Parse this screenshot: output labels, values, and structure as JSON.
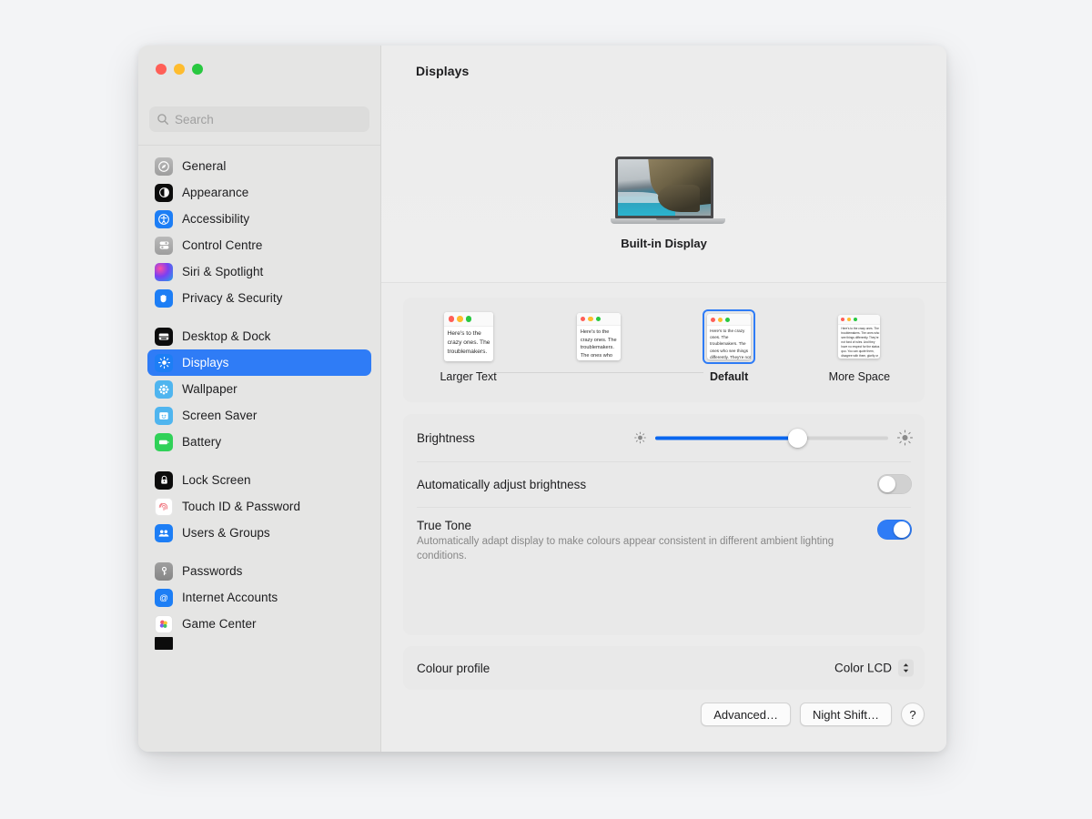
{
  "window": {
    "traffic_lights": [
      "close",
      "minimise",
      "zoom"
    ],
    "accent_color": "#2f7cf6"
  },
  "sidebar": {
    "search": {
      "placeholder": "Search",
      "value": ""
    },
    "groups": [
      {
        "items": [
          {
            "label": "General",
            "icon": "general-icon",
            "selected": false
          },
          {
            "label": "Appearance",
            "icon": "appearance-icon",
            "selected": false
          },
          {
            "label": "Accessibility",
            "icon": "accessibility-icon",
            "selected": false
          },
          {
            "label": "Control Centre",
            "icon": "control-centre-icon",
            "selected": false
          },
          {
            "label": "Siri & Spotlight",
            "icon": "siri-spotlight-icon",
            "selected": false
          },
          {
            "label": "Privacy & Security",
            "icon": "privacy-security-icon",
            "selected": false
          }
        ]
      },
      {
        "items": [
          {
            "label": "Desktop & Dock",
            "icon": "desktop-dock-icon",
            "selected": false
          },
          {
            "label": "Displays",
            "icon": "displays-icon",
            "selected": true
          },
          {
            "label": "Wallpaper",
            "icon": "wallpaper-icon",
            "selected": false
          },
          {
            "label": "Screen Saver",
            "icon": "screen-saver-icon",
            "selected": false
          },
          {
            "label": "Battery",
            "icon": "battery-icon",
            "selected": false
          }
        ]
      },
      {
        "items": [
          {
            "label": "Lock Screen",
            "icon": "lock-screen-icon",
            "selected": false
          },
          {
            "label": "Touch ID & Password",
            "icon": "touch-id-icon",
            "selected": false
          },
          {
            "label": "Users & Groups",
            "icon": "users-groups-icon",
            "selected": false
          }
        ]
      },
      {
        "items": [
          {
            "label": "Passwords",
            "icon": "passwords-icon",
            "selected": false
          },
          {
            "label": "Internet Accounts",
            "icon": "internet-accounts-icon",
            "selected": false
          },
          {
            "label": "Game Center",
            "icon": "game-center-icon",
            "selected": false
          }
        ]
      }
    ]
  },
  "main": {
    "title": "Displays",
    "display": {
      "name": "Built-in Display"
    },
    "scale": {
      "options": [
        {
          "label": "Larger Text",
          "selected": false,
          "preview_text": "Here's to the crazy ones. The troublemakers."
        },
        {
          "label": "",
          "selected": false,
          "preview_text": "Here's to the crazy ones. The troublemakers. The ones who"
        },
        {
          "label": "Default",
          "selected": true,
          "preview_text": "Here's to the crazy ones. The troublemakers. The ones who see things differently. They're not fond of rules. And they"
        },
        {
          "label": "More Space",
          "selected": false,
          "preview_text": "Here's to the crazy ones. The troublemakers. The ones who see things differently. They're not fond of rules. And they have no respect for the status quo. You can quote them, disagree with them, glorify or vilify them. About the only thing you can't do is ignore them. Because they change things."
        }
      ]
    },
    "brightness": {
      "label": "Brightness",
      "value_percent": 61,
      "min_icon": "low-brightness-icon",
      "max_icon": "high-brightness-icon"
    },
    "auto_brightness": {
      "label": "Automatically adjust brightness",
      "enabled": false
    },
    "true_tone": {
      "label": "True Tone",
      "description": "Automatically adapt display to make colours appear consistent in different ambient lighting conditions.",
      "enabled": true
    },
    "colour_profile": {
      "label": "Colour profile",
      "value": "Color LCD"
    },
    "footer": {
      "advanced_label": "Advanced…",
      "night_shift_label": "Night Shift…",
      "help_label": "?"
    }
  }
}
